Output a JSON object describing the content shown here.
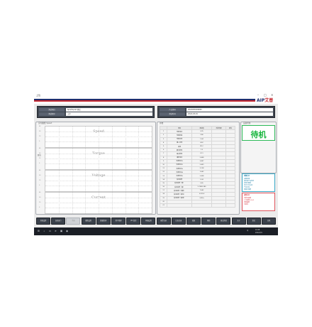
{
  "window": {
    "title": "上位",
    "controls": [
      "–",
      "□",
      "✕"
    ]
  },
  "brand": {
    "logo_main": "AIP",
    "logo_accent": "艾普"
  },
  "colors": {
    "navy": "#1f2e6e",
    "red": "#c4262e",
    "status_green": "#16b53c",
    "alarm_blue": "#1d7fa6",
    "alarm_red": "#d2323c"
  },
  "info_left": [
    {
      "label": "测试项目",
      "value": "Spd/Trq/U/I 测试"
    },
    {
      "label": "测试程序",
      "value": "工步"
    }
  ],
  "info_right": [
    {
      "label": "产品条码",
      "value": "2024030100001"
    },
    {
      "label": "测试时间",
      "value": "2024-03-01"
    }
  ],
  "charts_panel": {
    "title": "实时曲线 Speed",
    "y_label": "数值",
    "charts": [
      {
        "title": "Speed",
        "ticks": [
          "45",
          "30",
          "15",
          "0"
        ]
      },
      {
        "title": "Torque",
        "ticks": [
          "45",
          "30",
          "15",
          "0"
        ]
      },
      {
        "title": "Voltage",
        "ticks": [
          "45",
          "30",
          "15",
          "0"
        ]
      },
      {
        "title": "Current",
        "ticks": [
          "45",
          "30",
          "15",
          "0"
        ]
      }
    ]
  },
  "params_panel": {
    "title": "参数",
    "headers": [
      "",
      "项目",
      "测试值",
      "判定结果",
      "单位"
    ],
    "groups": [
      {
        "name": "性能测试",
        "rows": [
          [
            "1",
            "空载电流",
            "0.35",
            "",
            ""
          ],
          [
            "2",
            "空载转速",
            "2.46",
            "",
            ""
          ],
          [
            "3",
            "空载功率",
            "1.44",
            "",
            ""
          ],
          [
            "4",
            "输入功率",
            "4.62",
            "",
            ""
          ],
          [
            "5",
            "效率",
            "89.2",
            "",
            ""
          ],
          [
            "6",
            "额定转矩",
            "1.5",
            "",
            ""
          ]
        ]
      },
      {
        "name": "负载测试",
        "rows": [
          [
            "7",
            "最大转矩",
            "22.1",
            "",
            ""
          ],
          [
            "8",
            "堵转电流",
            "2.468",
            "",
            ""
          ],
          [
            "9",
            "负载电流1",
            "3.467",
            "",
            ""
          ],
          [
            "10",
            "负载电流2",
            "2.469",
            "",
            ""
          ],
          [
            "11",
            "负载电流3",
            "3.128",
            "",
            ""
          ],
          [
            "12",
            "负载电流4",
            "1.642",
            "",
            ""
          ],
          [
            "13",
            "负载电流5",
            "2.438",
            "",
            ""
          ]
        ]
      },
      {
        "name": "其它",
        "rows": [
          [
            "14",
            "反电动势",
            "5.34",
            "",
            ""
          ],
          [
            "15",
            "反电动势（线）",
            "0.65",
            "",
            ""
          ],
          [
            "16",
            "反电动势（相）",
            "1.234/0.345",
            "",
            ""
          ],
          [
            "17",
            "反电动势（常数）",
            "7.642",
            "",
            ""
          ],
          [
            "18",
            "反电动势（相位）",
            "6.3/3.4",
            "",
            ""
          ],
          [
            "19",
            "反电动势（频率）",
            "3.4V/s",
            "",
            ""
          ],
          [
            "20",
            "",
            "",
            "",
            ""
          ],
          [
            "21",
            "",
            "",
            "",
            ""
          ]
        ]
      }
    ]
  },
  "status_panel": {
    "title": "设备状态",
    "state": "待机"
  },
  "alarm_info": {
    "title": "报警信息",
    "lines": [
      "设备就绪",
      "请扫描产品条码",
      "急停已释放",
      "安全门已关闭",
      "气压正常",
      "伺服已使能"
    ]
  },
  "fault_info": {
    "title": "故障信息",
    "lines": [
      "当前无故障",
      "上次故障 03-01",
      "温度超限",
      "已复位"
    ]
  },
  "buttons": [
    "系统设置",
    "自动运行",
    "手动",
    "参数设置",
    "数据查询",
    "用户管理",
    "I/O 监控",
    "伺服设置",
    "报警记录",
    "日志记录",
    "校准",
    "帮助",
    "退出系统",
    "关于",
    "复位",
    "关机"
  ],
  "taskbar": {
    "icons": [
      "⊞",
      "⌕",
      "▭",
      "e",
      "▣",
      "◉"
    ],
    "time": "10:28",
    "date": "2024/3/1",
    "lang": "中"
  }
}
